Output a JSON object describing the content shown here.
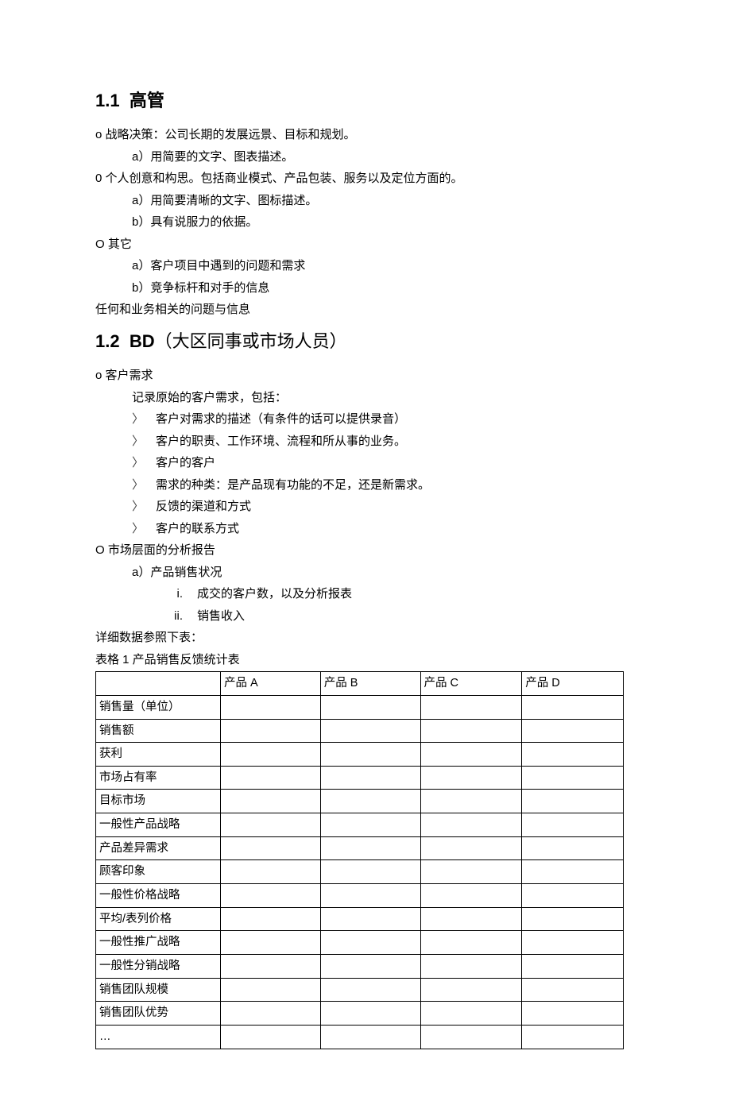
{
  "section1": {
    "number": "1.1",
    "title": "高管",
    "items": [
      {
        "type": "o",
        "text": "战略决策：公司长期的发展远景、目标和规划。",
        "subs": [
          {
            "label": "a）",
            "text": "用简要的文字、图表描述。"
          }
        ]
      },
      {
        "type": "0",
        "text": "个人创意和构思。包括商业模式、产品包装、服务以及定位方面的。",
        "subs": [
          {
            "label": "a）",
            "text": "用简要清晰的文字、图标描述。"
          },
          {
            "label": "b）",
            "text": "具有说服力的依据。"
          }
        ]
      },
      {
        "type": "O",
        "text": "其它",
        "subs": [
          {
            "label": "a）",
            "text": "客户项目中遇到的问题和需求"
          },
          {
            "label": "b）",
            "text": "竞争标杆和对手的信息"
          }
        ]
      }
    ],
    "trailing": "任何和业务相关的问题与信息"
  },
  "section2": {
    "number": "1.2",
    "title_bold": "BD",
    "title_paren": "（大区同事或市场人员）",
    "req": {
      "bullet": "o",
      "title": "客户需求",
      "intro": "记录原始的客户需求，包括：",
      "points": [
        "客户对需求的描述（有条件的话可以提供录音）",
        "客户的职责、工作环境、流程和所从事的业务。",
        "客户的客户",
        "需求的种类：是产品现有功能的不足，还是新需求。",
        "反馈的渠道和方式",
        "客户的联系方式"
      ]
    },
    "market": {
      "bullet": "O",
      "title": "市场层面的分析报告",
      "a_label": "a）",
      "a_text": "产品销售状况",
      "roman": [
        {
          "n": "i.",
          "t": "成交的客户数，以及分析报表"
        },
        {
          "n": "ii.",
          "t": "销售收入"
        }
      ]
    },
    "table_intro": "详细数据参照下表：",
    "table_caption": "表格 1 产品销售反馈统计表"
  },
  "table": {
    "headers": [
      "",
      "产品 A",
      "产品 B",
      "产品 C",
      "产品 D"
    ],
    "rows": [
      "销售量（单位）",
      "销售额",
      "获利",
      "市场占有率",
      "目标市场",
      "一般性产品战略",
      "产品差异需求",
      "顾客印象",
      "一般性价格战略",
      "平均/表列价格",
      "一般性推广战略",
      "一般性分销战略",
      "销售团队规模",
      "销售团队优势",
      "…"
    ]
  }
}
